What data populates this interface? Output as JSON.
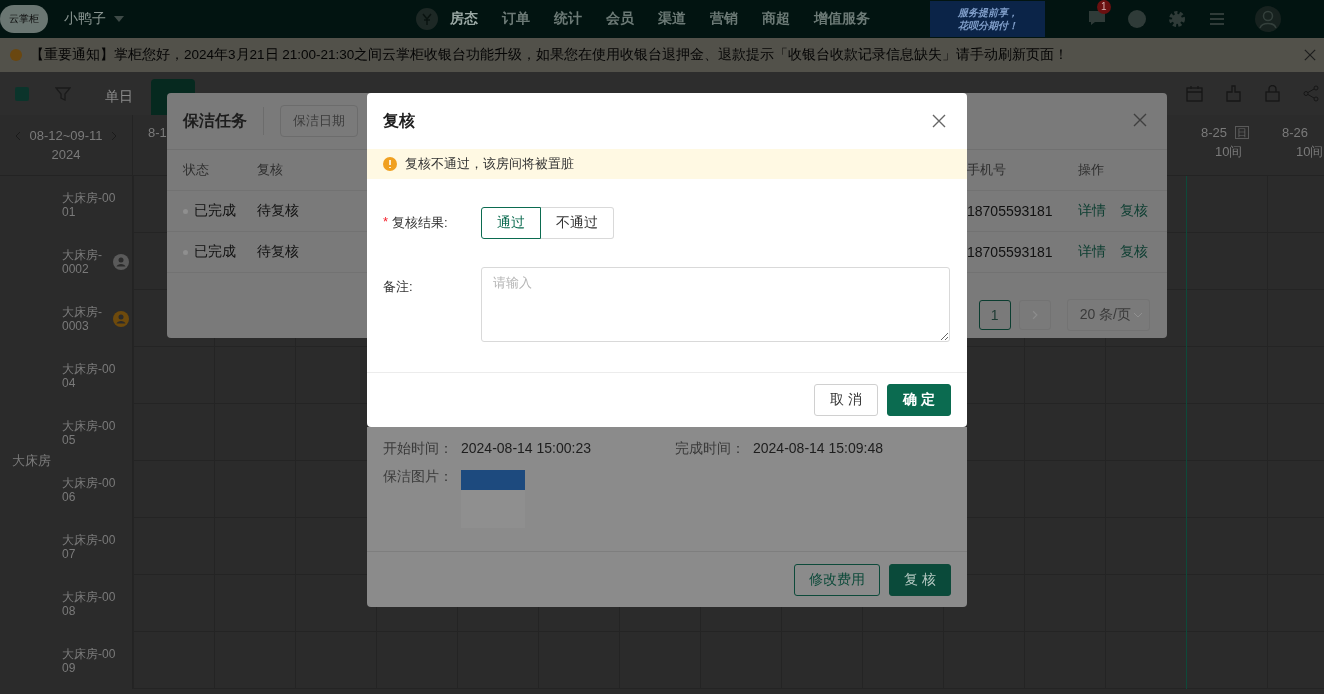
{
  "top_bar": {
    "logo": "云掌柜",
    "store": "小鸭子",
    "nav": [
      {
        "label": "房态",
        "selected": true
      },
      {
        "label": "订单",
        "selected": false
      },
      {
        "label": "统计",
        "selected": false
      },
      {
        "label": "会员",
        "selected": false
      },
      {
        "label": "渠道",
        "selected": false
      },
      {
        "label": "营销",
        "selected": false
      },
      {
        "label": "商超",
        "selected": false
      },
      {
        "label": "增值服务",
        "selected": false
      }
    ],
    "promo": [
      "服务提前享，",
      "花呗分期付！"
    ],
    "message_badge": "1"
  },
  "notice": "【重要通知】掌柜您好，2024年3月21日 21:00-21:30之间云掌柜收银台功能升级，如果您在使用收银台退押金、退款提示「收银台收款记录信息缺失」请手动刷新页面！",
  "toolbar": {
    "view_tabs": [
      {
        "label": "单日",
        "selected": false
      },
      {
        "selected": true
      }
    ]
  },
  "calendar": {
    "range": "08-12~09-11",
    "year": "2024",
    "columns": [
      {
        "date": "8-1",
        "today": false
      },
      {
        "date": "8-25",
        "mark": "日",
        "rooms": "10间",
        "today": true
      },
      {
        "date": "8-26",
        "rooms": "10间",
        "today": false
      }
    ],
    "group": "大床房",
    "rooms": [
      {
        "name": "大床房-0001"
      },
      {
        "name": "大床房-0002",
        "color": "#5a5a5a"
      },
      {
        "name": "大床房-0003",
        "color": "#6e4a0c"
      },
      {
        "name": "大床房-0004"
      },
      {
        "name": "大床房-0005"
      },
      {
        "name": "大床房-0006"
      },
      {
        "name": "大床房-0007"
      },
      {
        "name": "大床房-0008"
      },
      {
        "name": "大床房-0009"
      }
    ]
  },
  "cleaning_dialog": {
    "title": "保洁任务",
    "date_filter": "保洁日期",
    "columns": [
      "状态",
      "复核",
      "手机号",
      "操作"
    ],
    "rows": [
      {
        "status": "已完成",
        "review": "待复核",
        "phone": "18705593181",
        "actions": [
          "详情",
          "复核"
        ]
      },
      {
        "status": "已完成",
        "review": "待复核",
        "phone": "18705593181",
        "actions": [
          "详情",
          "复核"
        ]
      }
    ],
    "pagination": {
      "pages": [
        {
          "label": "1",
          "selected": true
        }
      ],
      "page_size": "20 条/页"
    }
  },
  "details_dialog": {
    "fields": [
      {
        "label": "开始时间：",
        "value": "2024-08-14 15:00:23"
      },
      {
        "label": "完成时间：",
        "value": "2024-08-14 15:09:48"
      }
    ],
    "photo_label": "保洁图片：",
    "buttons": [
      {
        "label": "修改费用",
        "kind": "default"
      },
      {
        "label": "复 核",
        "kind": "primary"
      }
    ]
  },
  "review_modal": {
    "title": "复核",
    "warning": "复核不通过，该房间将被置脏",
    "required_mark": "*",
    "result_label": "复核结果:",
    "options": [
      {
        "label": "通过",
        "selected": true
      },
      {
        "label": "不通过",
        "selected": false
      }
    ],
    "remark_label": "备注:",
    "remark_placeholder": "请输入",
    "buttons": [
      {
        "label": "取 消",
        "kind": "default"
      },
      {
        "label": "确 定",
        "kind": "primary"
      }
    ]
  }
}
